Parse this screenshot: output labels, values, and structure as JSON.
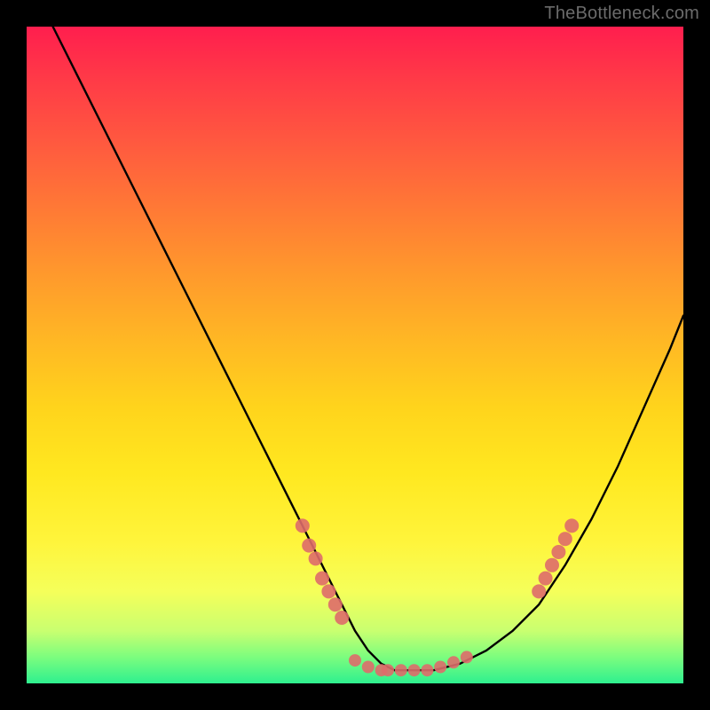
{
  "branding": {
    "watermark": "TheBottleneck.com"
  },
  "chart_data": {
    "type": "line",
    "title": "",
    "xlabel": "",
    "ylabel": "",
    "xlim": [
      0,
      100
    ],
    "ylim": [
      0,
      100
    ],
    "grid": false,
    "legend": false,
    "series": [
      {
        "name": "bottleneck-curve",
        "x": [
          4,
          8,
          12,
          16,
          20,
          24,
          28,
          32,
          36,
          40,
          42,
          44,
          46,
          48,
          50,
          52,
          54,
          56,
          58,
          62,
          66,
          70,
          74,
          78,
          82,
          86,
          90,
          94,
          98,
          100
        ],
        "y": [
          100,
          92,
          84,
          76,
          68,
          60,
          52,
          44,
          36,
          28,
          24,
          20,
          16,
          12,
          8,
          5,
          3,
          2,
          2,
          2,
          3,
          5,
          8,
          12,
          18,
          25,
          33,
          42,
          51,
          56
        ]
      }
    ],
    "markers": [
      {
        "name": "left-cluster",
        "color": "#de6c6a",
        "radius": 8,
        "points": [
          {
            "x": 42,
            "y": 24
          },
          {
            "x": 43,
            "y": 21
          },
          {
            "x": 44,
            "y": 19
          },
          {
            "x": 45,
            "y": 16
          },
          {
            "x": 46,
            "y": 14
          },
          {
            "x": 47,
            "y": 12
          },
          {
            "x": 48,
            "y": 10
          }
        ]
      },
      {
        "name": "bottom-cluster",
        "color": "#de6c6a",
        "radius": 7,
        "points": [
          {
            "x": 50,
            "y": 3.5
          },
          {
            "x": 52,
            "y": 2.5
          },
          {
            "x": 54,
            "y": 2
          },
          {
            "x": 55,
            "y": 2
          },
          {
            "x": 57,
            "y": 2
          },
          {
            "x": 59,
            "y": 2
          },
          {
            "x": 61,
            "y": 2
          },
          {
            "x": 63,
            "y": 2.5
          },
          {
            "x": 65,
            "y": 3.2
          },
          {
            "x": 67,
            "y": 4
          }
        ]
      },
      {
        "name": "right-cluster",
        "color": "#de6c6a",
        "radius": 8,
        "points": [
          {
            "x": 78,
            "y": 14
          },
          {
            "x": 79,
            "y": 16
          },
          {
            "x": 80,
            "y": 18
          },
          {
            "x": 81,
            "y": 20
          },
          {
            "x": 82,
            "y": 22
          },
          {
            "x": 83,
            "y": 24
          }
        ]
      }
    ],
    "background_gradient": {
      "orientation": "vertical",
      "stops": [
        {
          "pos": 0,
          "color": "#ff1e4e"
        },
        {
          "pos": 50,
          "color": "#ffb824"
        },
        {
          "pos": 80,
          "color": "#fff43a"
        },
        {
          "pos": 100,
          "color": "#2ef08f"
        }
      ]
    }
  }
}
